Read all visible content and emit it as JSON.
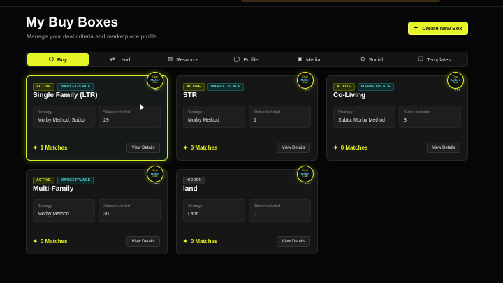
{
  "header": {
    "title": "My Buy Boxes",
    "subtitle": "Manage your deal criteria and marketplace profile",
    "create_label": "Create New Box",
    "create_icon": "plus-icon"
  },
  "tabs": [
    {
      "label": "Buy",
      "icon": "box-icon",
      "glyph": "⬡",
      "active": true
    },
    {
      "label": "Lend",
      "icon": "handshake-icon",
      "glyph": "⇄",
      "active": false
    },
    {
      "label": "Resource",
      "icon": "building-icon",
      "glyph": "▥",
      "active": false
    },
    {
      "label": "Profile",
      "icon": "user-icon",
      "glyph": "◯",
      "active": false
    },
    {
      "label": "Media",
      "icon": "image-icon",
      "glyph": "▣",
      "active": false
    },
    {
      "label": "Social",
      "icon": "globe-icon",
      "glyph": "⊕",
      "active": false
    },
    {
      "label": "Templates",
      "icon": "copy-icon",
      "glyph": "❐",
      "active": false
    }
  ],
  "cards": [
    {
      "title": "Single Family (LTR)",
      "badges": [
        {
          "label": "ACTIVE",
          "kind": "active"
        },
        {
          "label": "MARKETPLACE",
          "kind": "market"
        }
      ],
      "strategy_label": "Strategy",
      "strategy": "Morby Method, Subto",
      "states_label": "States Included",
      "states": "29",
      "matches": "1 Matches",
      "view_label": "View Details",
      "highlighted": true
    },
    {
      "title": "STR",
      "badges": [
        {
          "label": "ACTIVE",
          "kind": "active"
        },
        {
          "label": "MARKETPLACE",
          "kind": "market"
        }
      ],
      "strategy_label": "Strategy",
      "strategy": "Morby Method",
      "states_label": "States Included",
      "states": "1",
      "matches": "0 Matches",
      "view_label": "View Details",
      "highlighted": false
    },
    {
      "title": "Co-Living",
      "badges": [
        {
          "label": "ACTIVE",
          "kind": "active"
        },
        {
          "label": "MARKETPLACE",
          "kind": "market"
        }
      ],
      "strategy_label": "Strategy",
      "strategy": "Subto, Morby Method",
      "states_label": "States Included",
      "states": "3",
      "matches": "0 Matches",
      "view_label": "View Details",
      "highlighted": false
    },
    {
      "title": "Multi-Family",
      "badges": [
        {
          "label": "ACTIVE",
          "kind": "active"
        },
        {
          "label": "MARKETPLACE",
          "kind": "market"
        }
      ],
      "strategy_label": "Strategy",
      "strategy": "Morby Method",
      "states_label": "States Included",
      "states": "30",
      "matches": "0 Matches",
      "view_label": "View Details",
      "highlighted": false
    },
    {
      "title": "land",
      "badges": [
        {
          "label": "HIDDEN",
          "kind": "hidden"
        }
      ],
      "strategy_label": "Strategy",
      "strategy": "Land",
      "states_label": "States Included",
      "states": "0",
      "matches": "0 Matches",
      "view_label": "View Details",
      "highlighted": false
    }
  ],
  "club_logo": {
    "line1": "Deal",
    "line2": "Maker",
    "line3": "Club"
  },
  "colors": {
    "accent": "#e4f424",
    "marketplace": "#5ad6d2",
    "background": "#060606"
  }
}
